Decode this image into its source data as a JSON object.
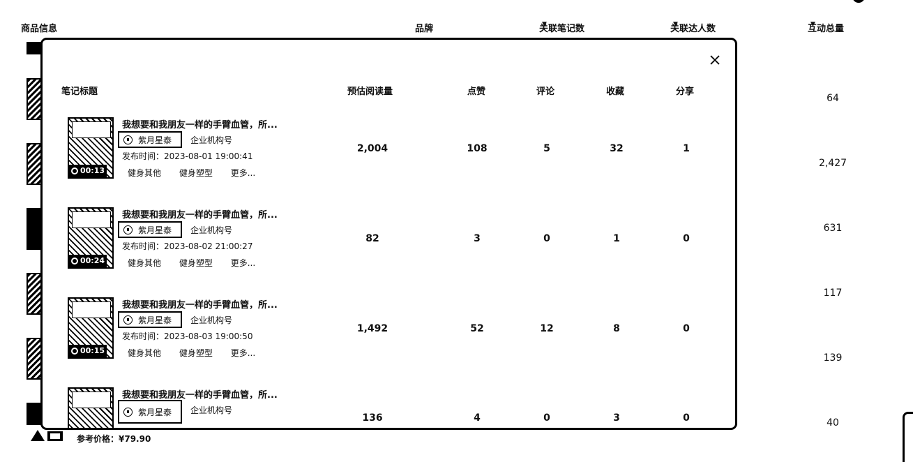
{
  "background_table": {
    "columns": [
      {
        "label": "商品信息",
        "sortable": false
      },
      {
        "label": "品牌",
        "sortable": false
      },
      {
        "label": "关联笔记数",
        "sortable": true
      },
      {
        "label": "关联达人数",
        "sortable": true
      },
      {
        "label": "互动总量",
        "sortable": true
      }
    ],
    "interaction_totals": [
      "64",
      "2,427",
      "631",
      "117",
      "139",
      "40"
    ],
    "reference_price": "参考价格：¥79.90"
  },
  "modal": {
    "columns": [
      "笔记标题",
      "预估阅读量",
      "点赞",
      "评论",
      "收藏",
      "分享"
    ],
    "rows": [
      {
        "title": "我想要和我朋友一样的手臂血管，所...",
        "author": "紫月星泰",
        "account_type": "企业机构号",
        "publish_time": "发布时间：2023-08-01 19:00:41",
        "tags": [
          "健身其他",
          "健身塑型",
          "更多..."
        ],
        "duration": "00:13",
        "reads": "2,004",
        "likes": "108",
        "comments": "5",
        "favorites": "32",
        "shares": "1"
      },
      {
        "title": "我想要和我朋友一样的手臂血管，所...",
        "author": "紫月星泰",
        "account_type": "企业机构号",
        "publish_time": "发布时间：2023-08-02 21:00:27",
        "tags": [
          "健身其他",
          "健身塑型",
          "更多..."
        ],
        "duration": "00:24",
        "reads": "82",
        "likes": "3",
        "comments": "0",
        "favorites": "1",
        "shares": "0"
      },
      {
        "title": "我想要和我朋友一样的手臂血管，所...",
        "author": "紫月星泰",
        "account_type": "企业机构号",
        "publish_time": "发布时间：2023-08-03 19:00:50",
        "tags": [
          "健身其他",
          "健身塑型",
          "更多..."
        ],
        "duration": "00:15",
        "reads": "1,492",
        "likes": "52",
        "comments": "12",
        "favorites": "8",
        "shares": "0"
      },
      {
        "title": "我想要和我朋友一样的手臂血管，所...",
        "author": "紫月星泰",
        "account_type": "企业机构号",
        "publish_time": "",
        "tags": [],
        "duration": "",
        "reads": "136",
        "likes": "4",
        "comments": "0",
        "favorites": "3",
        "shares": "0"
      }
    ]
  },
  "icons": {
    "close": "close-icon",
    "sort": "caret-down-icon",
    "author": "author-avatar-icon",
    "play": "play-icon"
  }
}
